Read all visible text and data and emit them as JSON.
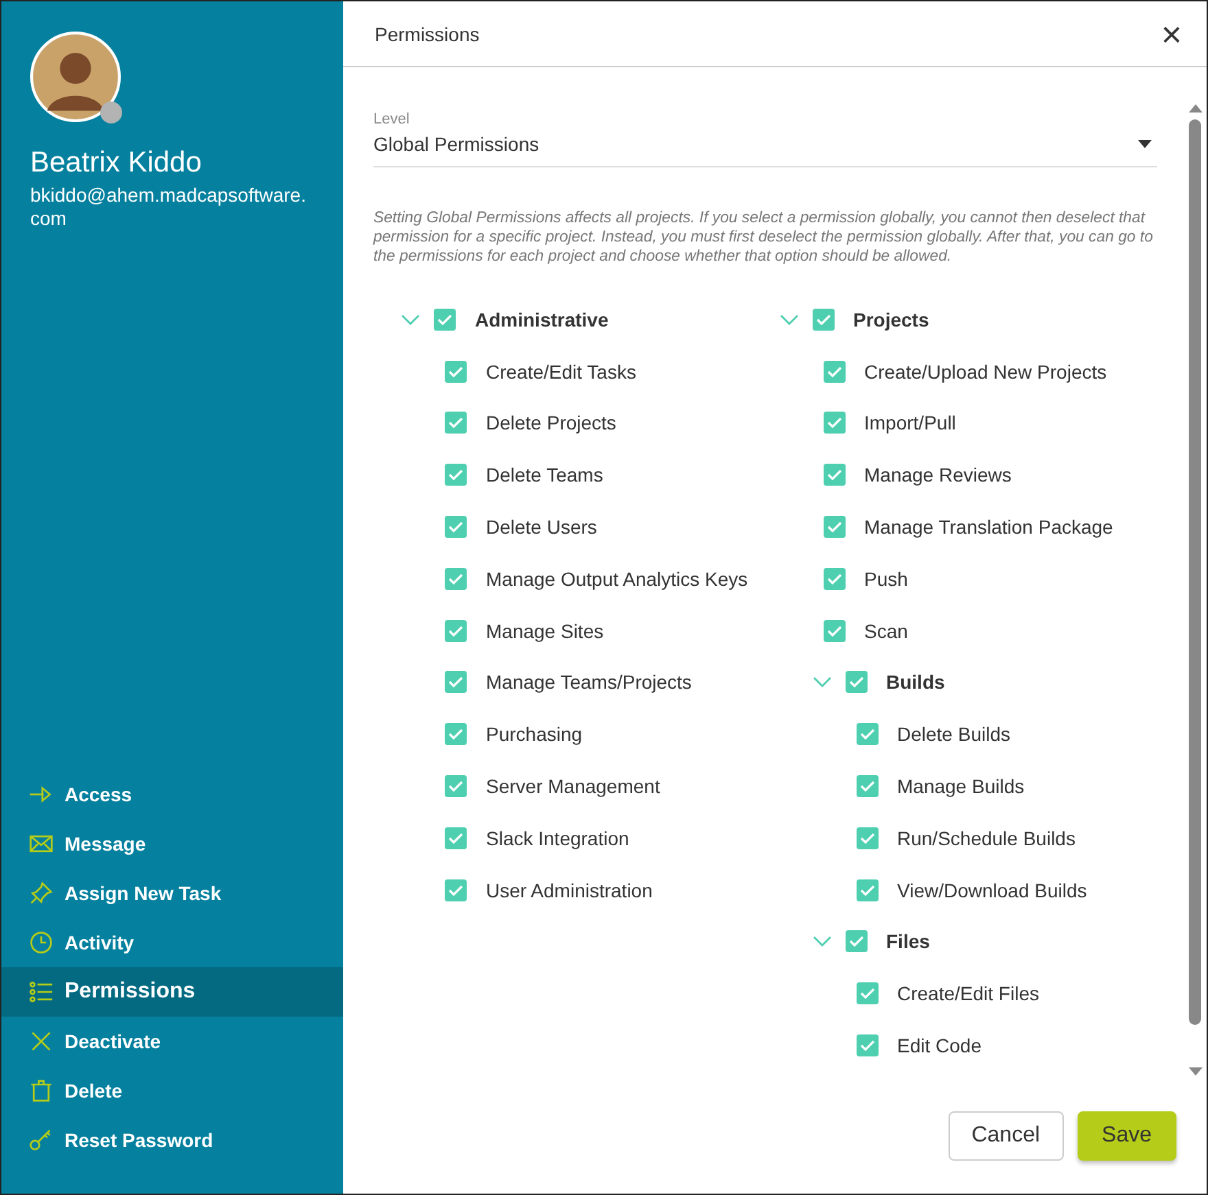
{
  "user": {
    "name": "Beatrix Kiddo",
    "email": "bkiddo@ahem.madcapsoftware.com",
    "online": false
  },
  "sidebar": {
    "items": [
      {
        "label": "Access",
        "selected": false
      },
      {
        "label": "Message",
        "selected": false
      },
      {
        "label": "Assign New Task",
        "selected": false
      },
      {
        "label": "Activity",
        "selected": false
      },
      {
        "label": "Permissions",
        "selected": true
      },
      {
        "label": "Deactivate",
        "selected": false
      },
      {
        "label": "Delete",
        "selected": false
      },
      {
        "label": "Reset Password",
        "selected": false
      }
    ]
  },
  "dialog": {
    "tab": "Permissions",
    "close": "×"
  },
  "level": {
    "label": "Level",
    "value": "Global Permissions"
  },
  "note": "Setting Global Permissions affects all projects. If you select a permission globally, you cannot then deselect that permission for a specific project. Instead, you must first deselect the permission globally. After that, you can go to the permissions for each project and choose whether that option should be allowed.",
  "permission_groups": [
    {
      "label": "Administrative",
      "checked": true,
      "expanded": true,
      "children": [
        {
          "label": "Create/Edit Tasks",
          "checked": true
        },
        {
          "label": "Delete Projects",
          "checked": true
        },
        {
          "label": "Delete Teams",
          "checked": true
        },
        {
          "label": "Delete Users",
          "checked": true
        },
        {
          "label": "Manage Output Analytics Keys",
          "checked": true
        },
        {
          "label": "Manage Sites",
          "checked": true
        },
        {
          "label": "Manage Teams/Projects",
          "checked": true
        },
        {
          "label": "Purchasing",
          "checked": true
        },
        {
          "label": "Server Management",
          "checked": true
        },
        {
          "label": "Slack Integration",
          "checked": true
        },
        {
          "label": "User Administration",
          "checked": true
        }
      ]
    },
    {
      "label": "Projects",
      "checked": true,
      "expanded": true,
      "children": [
        {
          "label": "Create/Upload New Projects",
          "checked": true
        },
        {
          "label": "Import/Pull",
          "checked": true
        },
        {
          "label": "Manage Reviews",
          "checked": true
        },
        {
          "label": "Manage Translation Package",
          "checked": true
        },
        {
          "label": "Push",
          "checked": true
        },
        {
          "label": "Scan",
          "checked": true
        },
        {
          "label": "Builds",
          "checked": true,
          "expanded": true,
          "children": [
            {
              "label": "Delete Builds",
              "checked": true
            },
            {
              "label": "Manage Builds",
              "checked": true
            },
            {
              "label": "Run/Schedule Builds",
              "checked": true
            },
            {
              "label": "View/Download Builds",
              "checked": true
            }
          ]
        },
        {
          "label": "Files",
          "checked": true,
          "expanded": true,
          "children": [
            {
              "label": "Create/Edit Files",
              "checked": true
            },
            {
              "label": "Edit Code",
              "checked": true
            }
          ]
        }
      ]
    }
  ],
  "buttons": {
    "cancel": "Cancel",
    "save": "Save"
  }
}
